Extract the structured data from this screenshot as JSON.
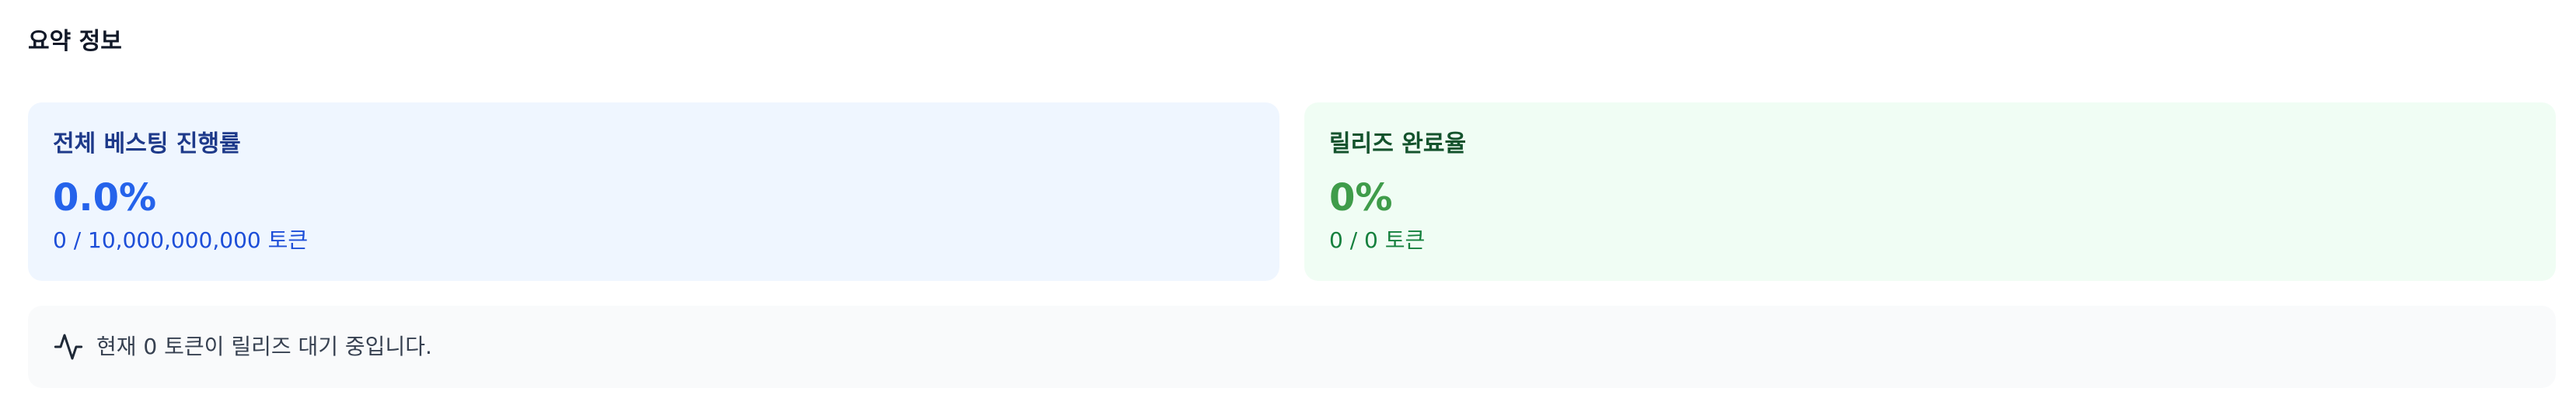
{
  "summary": {
    "title": "요약 정보"
  },
  "vesting_card": {
    "label": "전체 베스팅 진행률",
    "value": "0.0%",
    "sub": "0 / 10,000,000,000 토큰",
    "progress_percent": 0.0,
    "accent_color": "#2563eb",
    "background_color": "#eff6ff"
  },
  "release_card": {
    "label": "릴리즈 완료율",
    "value": "0%",
    "sub": "0 / 0 토큰",
    "progress_percent": 0,
    "accent_color": "#3f9c4a",
    "background_color": "#f0fdf4"
  },
  "notice": {
    "icon": "activity-icon",
    "text": "현재 0 토큰이 릴리즈 대기 중입니다."
  }
}
